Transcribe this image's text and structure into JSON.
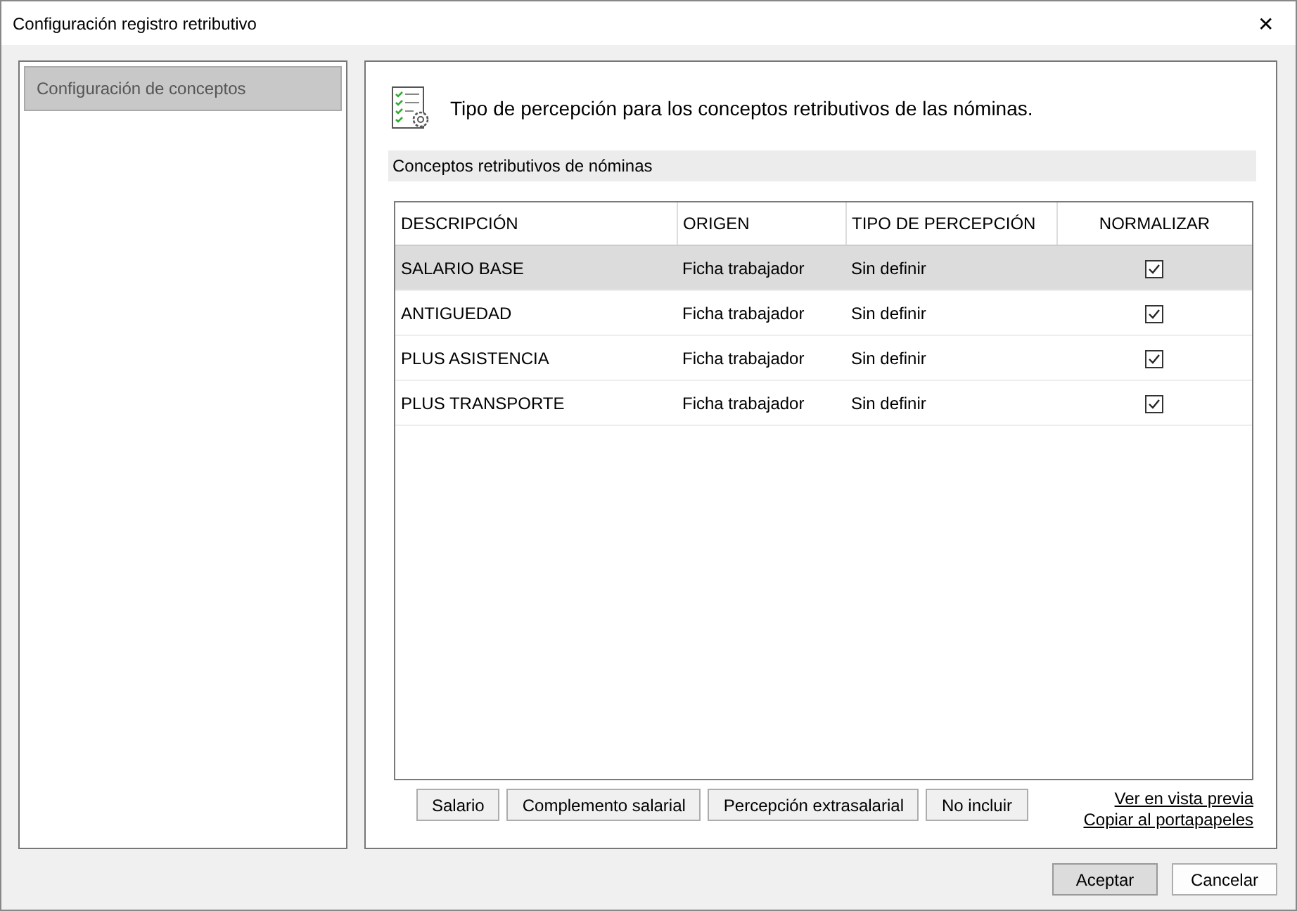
{
  "window": {
    "title": "Configuración registro retributivo",
    "close": "✕"
  },
  "sidebar": {
    "items": [
      {
        "label": "Configuración de conceptos",
        "selected": true
      }
    ]
  },
  "header": {
    "text": "Tipo de percepción para los conceptos retributivos de las nóminas."
  },
  "section": {
    "title": "Conceptos retributivos de nóminas"
  },
  "table": {
    "columns": [
      "DESCRIPCIÓN",
      "ORIGEN",
      "TIPO DE PERCEPCIÓN",
      "NORMALIZAR"
    ],
    "rows": [
      {
        "description": "SALARIO BASE",
        "origin": "Ficha trabajador",
        "type": "Sin definir",
        "normalize": true,
        "selected": true
      },
      {
        "description": "ANTIGUEDAD",
        "origin": "Ficha trabajador",
        "type": "Sin definir",
        "normalize": true,
        "selected": false
      },
      {
        "description": "PLUS ASISTENCIA",
        "origin": "Ficha trabajador",
        "type": "Sin definir",
        "normalize": true,
        "selected": false
      },
      {
        "description": "PLUS TRANSPORTE",
        "origin": "Ficha trabajador",
        "type": "Sin definir",
        "normalize": true,
        "selected": false
      }
    ]
  },
  "type_buttons": [
    "Salario",
    "Complemento salarial",
    "Percepción extrasalarial",
    "No incluir"
  ],
  "links": [
    "Ver en vista previa",
    "Copiar al portapapeles"
  ],
  "footer_buttons": [
    {
      "label": "Aceptar",
      "default": true
    },
    {
      "label": "Cancelar",
      "default": false
    }
  ]
}
